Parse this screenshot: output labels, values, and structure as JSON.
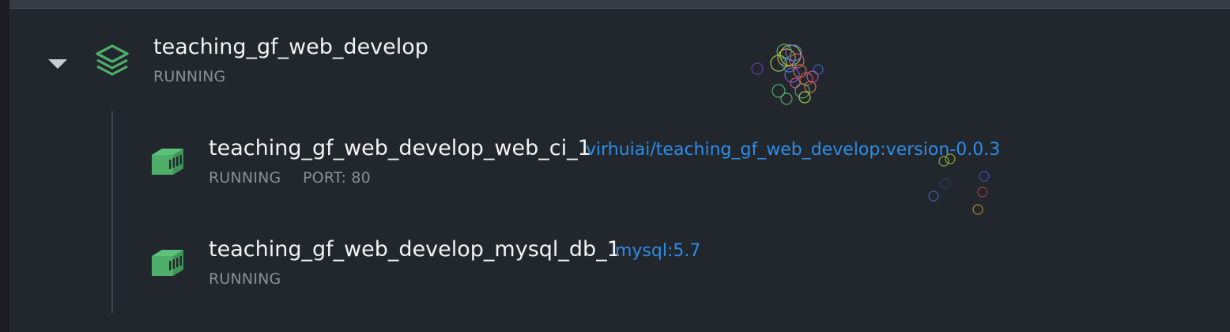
{
  "stack": {
    "name": "teaching_gf_web_develop",
    "status": "RUNNING",
    "icon": "stack-layers-icon",
    "expanded": true
  },
  "containers": [
    {
      "name": "teaching_gf_web_develop_web_ci_1",
      "image": "virhuiai/teaching_gf_web_develop:version-0.0.3",
      "status": "RUNNING",
      "port": "PORT: 80",
      "icon": "container-icon"
    },
    {
      "name": "teaching_gf_web_develop_mysql_db_1",
      "image": "mysql:5.7",
      "status": "RUNNING",
      "icon": "container-icon"
    }
  ],
  "colors": {
    "background": "#22262d",
    "running_green": "#4fae6a",
    "link_blue": "#2e8de5",
    "status_gray": "#8a8f96"
  }
}
